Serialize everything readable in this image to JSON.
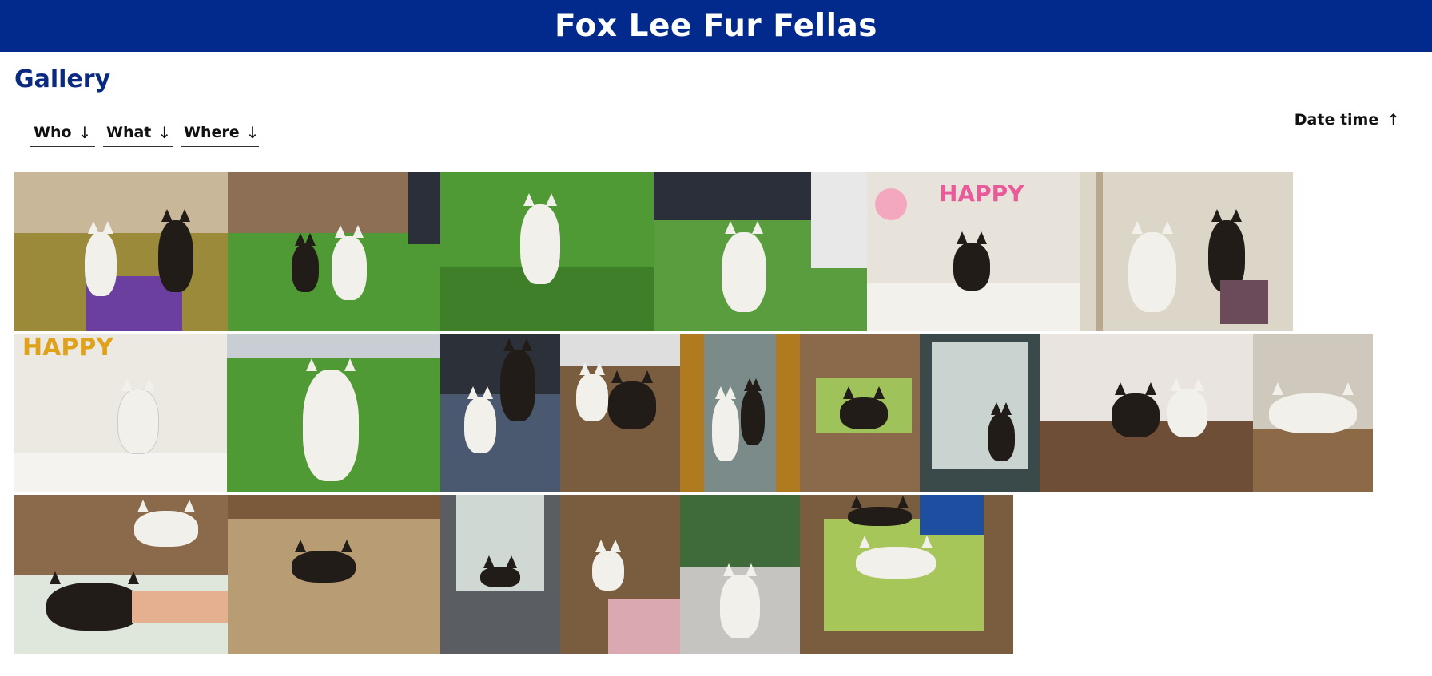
{
  "header": {
    "title": "Fox Lee Fur Fellas"
  },
  "gallery": {
    "title": "Gallery"
  },
  "filters": [
    {
      "label": "Who",
      "icon": "arrow-down-icon"
    },
    {
      "label": "What",
      "icon": "arrow-down-icon"
    },
    {
      "label": "Where",
      "icon": "arrow-down-icon"
    }
  ],
  "sort": {
    "label": "Date time",
    "icon": "arrow-up-icon"
  },
  "colors": {
    "header_bg": "#022a8c",
    "header_text": "#ffffff",
    "gallery_title": "#0a2a80",
    "grass": "#4f9a35",
    "wood_floor": "#7a5c3e",
    "white_dog": "#f2f0ea",
    "black_dog": "#221c18"
  },
  "photos": [
    {
      "scene": "living-room-two-dogs"
    },
    {
      "scene": "yard-dogs-playing"
    },
    {
      "scene": "grass-white-dog"
    },
    {
      "scene": "yard-white-dog-sitting"
    },
    {
      "scene": "birthday-black-dog"
    },
    {
      "scene": "hallway-two-dogs"
    },
    {
      "scene": "birthday-white-dog"
    },
    {
      "scene": "grass-white-dog-smiling"
    },
    {
      "scene": "car-two-dogs"
    },
    {
      "scene": "floor-two-dogs-lying"
    },
    {
      "scene": "door-two-dogs"
    },
    {
      "scene": "mat-black-dog-rolling"
    },
    {
      "scene": "window-black-dog"
    },
    {
      "scene": "floor-two-dogs-sitting"
    },
    {
      "scene": "floor-white-dog-sleeping"
    },
    {
      "scene": "blanket-two-dogs"
    },
    {
      "scene": "dirt-black-dog"
    },
    {
      "scene": "balcony-black-dog"
    },
    {
      "scene": "kitchen-white-dog-hand"
    },
    {
      "scene": "park-white-dog"
    },
    {
      "scene": "mat-two-dogs-sleeping"
    }
  ]
}
